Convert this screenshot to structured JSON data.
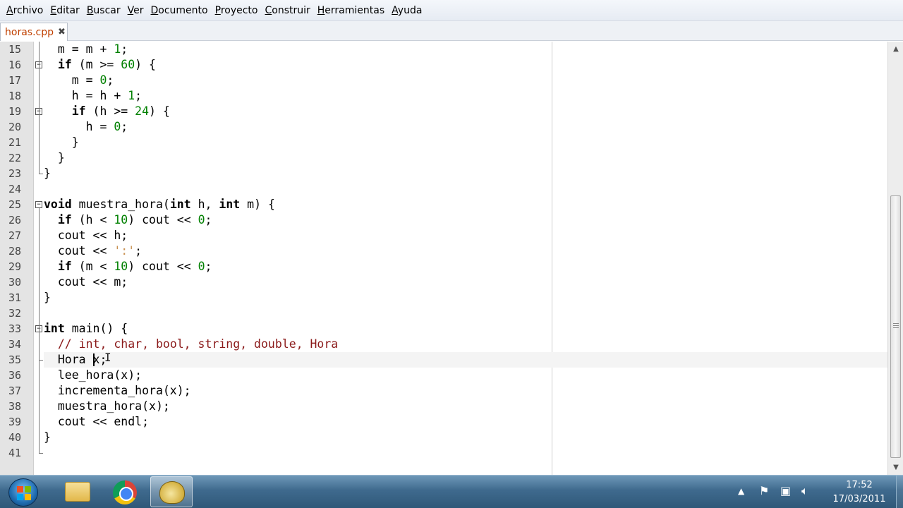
{
  "menu": [
    "Archivo",
    "Editar",
    "Buscar",
    "Ver",
    "Documento",
    "Proyecto",
    "Construir",
    "Herramientas",
    "Ayuda"
  ],
  "tab": {
    "label": "horas.cpp",
    "close": "✖"
  },
  "editor": {
    "lines": [
      {
        "n": "15",
        "code": [
          [
            "",
            "  m = m + "
          ],
          [
            "num",
            "1"
          ],
          [
            "",
            ";"
          ]
        ]
      },
      {
        "n": "16",
        "code": [
          [
            "",
            "  "
          ],
          [
            "kw",
            "if"
          ],
          [
            "",
            " (m >= "
          ],
          [
            "num",
            "60"
          ],
          [
            "",
            ") {"
          ]
        ]
      },
      {
        "n": "17",
        "code": [
          [
            "",
            "    m = "
          ],
          [
            "num",
            "0"
          ],
          [
            "",
            ";"
          ]
        ]
      },
      {
        "n": "18",
        "code": [
          [
            "",
            "    h = h + "
          ],
          [
            "num",
            "1"
          ],
          [
            "",
            ";"
          ]
        ]
      },
      {
        "n": "19",
        "code": [
          [
            "",
            "    "
          ],
          [
            "kw",
            "if"
          ],
          [
            "",
            " (h >= "
          ],
          [
            "num",
            "24"
          ],
          [
            "",
            ") {"
          ]
        ]
      },
      {
        "n": "20",
        "code": [
          [
            "",
            "      h = "
          ],
          [
            "num",
            "0"
          ],
          [
            "",
            ";"
          ]
        ]
      },
      {
        "n": "21",
        "code": [
          [
            "",
            "    }"
          ]
        ]
      },
      {
        "n": "22",
        "code": [
          [
            "",
            "  }"
          ]
        ]
      },
      {
        "n": "23",
        "code": [
          [
            "",
            "}"
          ]
        ]
      },
      {
        "n": "24",
        "code": []
      },
      {
        "n": "25",
        "code": [
          [
            "kw",
            "void"
          ],
          [
            "",
            " muestra_hora("
          ],
          [
            "kw",
            "int"
          ],
          [
            "",
            " h, "
          ],
          [
            "kw",
            "int"
          ],
          [
            "",
            " m) {"
          ]
        ]
      },
      {
        "n": "26",
        "code": [
          [
            "",
            "  "
          ],
          [
            "kw",
            "if"
          ],
          [
            "",
            " (h < "
          ],
          [
            "num",
            "10"
          ],
          [
            "",
            ") cout << "
          ],
          [
            "num",
            "0"
          ],
          [
            "",
            ";"
          ]
        ]
      },
      {
        "n": "27",
        "code": [
          [
            "",
            "  cout << h;"
          ]
        ]
      },
      {
        "n": "28",
        "code": [
          [
            "",
            "  cout << "
          ],
          [
            "str",
            "':'"
          ],
          [
            "",
            ";"
          ]
        ]
      },
      {
        "n": "29",
        "code": [
          [
            "",
            "  "
          ],
          [
            "kw",
            "if"
          ],
          [
            "",
            " (m < "
          ],
          [
            "num",
            "10"
          ],
          [
            "",
            ") cout << "
          ],
          [
            "num",
            "0"
          ],
          [
            "",
            ";"
          ]
        ]
      },
      {
        "n": "30",
        "code": [
          [
            "",
            "  cout << m;"
          ]
        ]
      },
      {
        "n": "31",
        "code": [
          [
            "",
            "}"
          ]
        ]
      },
      {
        "n": "32",
        "code": []
      },
      {
        "n": "33",
        "code": [
          [
            "kw",
            "int"
          ],
          [
            "",
            " main() {"
          ]
        ]
      },
      {
        "n": "34",
        "code": [
          [
            "",
            "  "
          ],
          [
            "cmt",
            "// int, char, bool, string, double, Hora"
          ]
        ]
      },
      {
        "n": "35",
        "code": [
          [
            "",
            "  Hora x;"
          ]
        ]
      },
      {
        "n": "36",
        "code": [
          [
            "",
            "  lee_hora(x);"
          ]
        ]
      },
      {
        "n": "37",
        "code": [
          [
            "",
            "  incrementa_hora(x);"
          ]
        ]
      },
      {
        "n": "38",
        "code": [
          [
            "",
            "  muestra_hora(x);"
          ]
        ]
      },
      {
        "n": "39",
        "code": [
          [
            "",
            "  cout << endl;"
          ]
        ]
      },
      {
        "n": "40",
        "code": [
          [
            "",
            "}"
          ]
        ]
      },
      {
        "n": "41",
        "code": []
      }
    ],
    "current_line": "35"
  },
  "taskbar": {
    "apps": [
      "folder-icon",
      "chrome-icon",
      "geany-icon"
    ],
    "tray": [
      "up-arrow-icon",
      "flag-icon",
      "network-icon",
      "volume-icon"
    ],
    "time": "17:52",
    "date": "17/03/2011"
  }
}
